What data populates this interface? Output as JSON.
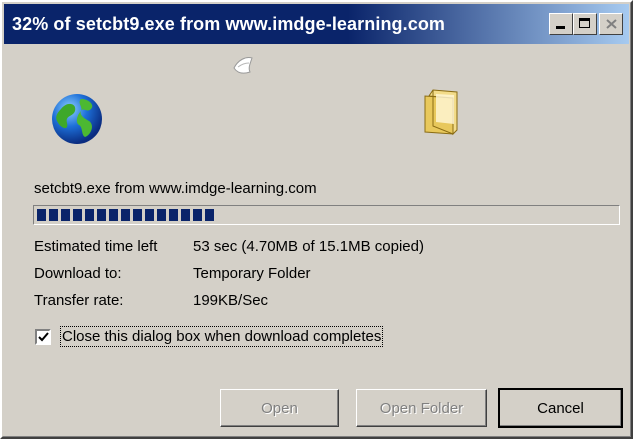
{
  "window": {
    "title": "32% of setcbt9.exe from www.imdge-learning.com"
  },
  "source": "setcbt9.exe from www.imdge-learning.com",
  "progress": {
    "fraction": 0.32
  },
  "info": {
    "time_left_label": "Estimated time left",
    "time_left_value": "53 sec (4.70MB of 15.1MB copied)",
    "download_to_label": "Download to:",
    "download_to_value": "Temporary Folder",
    "transfer_rate_label": "Transfer rate:",
    "transfer_rate_value": "199KB/Sec"
  },
  "checkbox": {
    "label": "Close this dialog box when download completes",
    "checked": true
  },
  "buttons": {
    "open": "Open",
    "open_folder": "Open Folder",
    "cancel": "Cancel"
  },
  "icons": {
    "globe": "globe-icon",
    "paper": "flying-document-icon",
    "folder": "folder-icon"
  },
  "colors": {
    "titlebar_start": "#0a246a",
    "titlebar_end": "#a6caf0",
    "dialog_bg": "#d4d0c8",
    "progress": "#0a246a"
  }
}
